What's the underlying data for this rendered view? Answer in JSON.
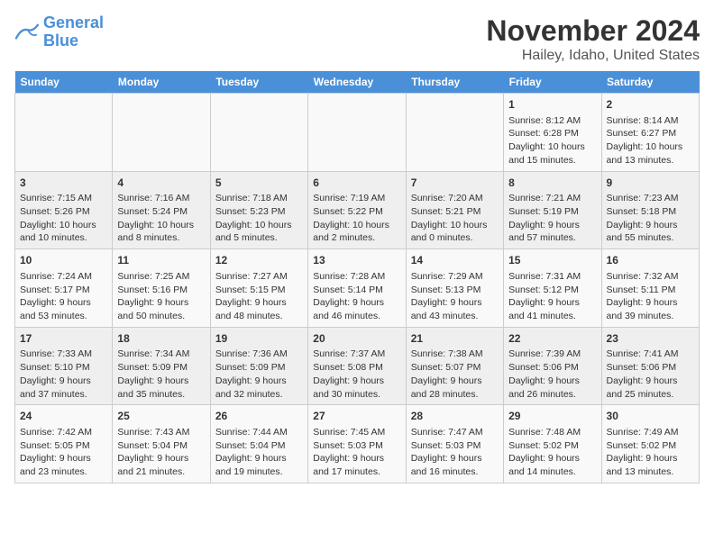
{
  "header": {
    "logo_line1": "General",
    "logo_line2": "Blue",
    "title": "November 2024",
    "subtitle": "Hailey, Idaho, United States"
  },
  "days_of_week": [
    "Sunday",
    "Monday",
    "Tuesday",
    "Wednesday",
    "Thursday",
    "Friday",
    "Saturday"
  ],
  "weeks": [
    [
      {
        "day": "",
        "info": ""
      },
      {
        "day": "",
        "info": ""
      },
      {
        "day": "",
        "info": ""
      },
      {
        "day": "",
        "info": ""
      },
      {
        "day": "",
        "info": ""
      },
      {
        "day": "1",
        "info": "Sunrise: 8:12 AM\nSunset: 6:28 PM\nDaylight: 10 hours and 15 minutes."
      },
      {
        "day": "2",
        "info": "Sunrise: 8:14 AM\nSunset: 6:27 PM\nDaylight: 10 hours and 13 minutes."
      }
    ],
    [
      {
        "day": "3",
        "info": "Sunrise: 7:15 AM\nSunset: 5:26 PM\nDaylight: 10 hours and 10 minutes."
      },
      {
        "day": "4",
        "info": "Sunrise: 7:16 AM\nSunset: 5:24 PM\nDaylight: 10 hours and 8 minutes."
      },
      {
        "day": "5",
        "info": "Sunrise: 7:18 AM\nSunset: 5:23 PM\nDaylight: 10 hours and 5 minutes."
      },
      {
        "day": "6",
        "info": "Sunrise: 7:19 AM\nSunset: 5:22 PM\nDaylight: 10 hours and 2 minutes."
      },
      {
        "day": "7",
        "info": "Sunrise: 7:20 AM\nSunset: 5:21 PM\nDaylight: 10 hours and 0 minutes."
      },
      {
        "day": "8",
        "info": "Sunrise: 7:21 AM\nSunset: 5:19 PM\nDaylight: 9 hours and 57 minutes."
      },
      {
        "day": "9",
        "info": "Sunrise: 7:23 AM\nSunset: 5:18 PM\nDaylight: 9 hours and 55 minutes."
      }
    ],
    [
      {
        "day": "10",
        "info": "Sunrise: 7:24 AM\nSunset: 5:17 PM\nDaylight: 9 hours and 53 minutes."
      },
      {
        "day": "11",
        "info": "Sunrise: 7:25 AM\nSunset: 5:16 PM\nDaylight: 9 hours and 50 minutes."
      },
      {
        "day": "12",
        "info": "Sunrise: 7:27 AM\nSunset: 5:15 PM\nDaylight: 9 hours and 48 minutes."
      },
      {
        "day": "13",
        "info": "Sunrise: 7:28 AM\nSunset: 5:14 PM\nDaylight: 9 hours and 46 minutes."
      },
      {
        "day": "14",
        "info": "Sunrise: 7:29 AM\nSunset: 5:13 PM\nDaylight: 9 hours and 43 minutes."
      },
      {
        "day": "15",
        "info": "Sunrise: 7:31 AM\nSunset: 5:12 PM\nDaylight: 9 hours and 41 minutes."
      },
      {
        "day": "16",
        "info": "Sunrise: 7:32 AM\nSunset: 5:11 PM\nDaylight: 9 hours and 39 minutes."
      }
    ],
    [
      {
        "day": "17",
        "info": "Sunrise: 7:33 AM\nSunset: 5:10 PM\nDaylight: 9 hours and 37 minutes."
      },
      {
        "day": "18",
        "info": "Sunrise: 7:34 AM\nSunset: 5:09 PM\nDaylight: 9 hours and 35 minutes."
      },
      {
        "day": "19",
        "info": "Sunrise: 7:36 AM\nSunset: 5:09 PM\nDaylight: 9 hours and 32 minutes."
      },
      {
        "day": "20",
        "info": "Sunrise: 7:37 AM\nSunset: 5:08 PM\nDaylight: 9 hours and 30 minutes."
      },
      {
        "day": "21",
        "info": "Sunrise: 7:38 AM\nSunset: 5:07 PM\nDaylight: 9 hours and 28 minutes."
      },
      {
        "day": "22",
        "info": "Sunrise: 7:39 AM\nSunset: 5:06 PM\nDaylight: 9 hours and 26 minutes."
      },
      {
        "day": "23",
        "info": "Sunrise: 7:41 AM\nSunset: 5:06 PM\nDaylight: 9 hours and 25 minutes."
      }
    ],
    [
      {
        "day": "24",
        "info": "Sunrise: 7:42 AM\nSunset: 5:05 PM\nDaylight: 9 hours and 23 minutes."
      },
      {
        "day": "25",
        "info": "Sunrise: 7:43 AM\nSunset: 5:04 PM\nDaylight: 9 hours and 21 minutes."
      },
      {
        "day": "26",
        "info": "Sunrise: 7:44 AM\nSunset: 5:04 PM\nDaylight: 9 hours and 19 minutes."
      },
      {
        "day": "27",
        "info": "Sunrise: 7:45 AM\nSunset: 5:03 PM\nDaylight: 9 hours and 17 minutes."
      },
      {
        "day": "28",
        "info": "Sunrise: 7:47 AM\nSunset: 5:03 PM\nDaylight: 9 hours and 16 minutes."
      },
      {
        "day": "29",
        "info": "Sunrise: 7:48 AM\nSunset: 5:02 PM\nDaylight: 9 hours and 14 minutes."
      },
      {
        "day": "30",
        "info": "Sunrise: 7:49 AM\nSunset: 5:02 PM\nDaylight: 9 hours and 13 minutes."
      }
    ]
  ]
}
